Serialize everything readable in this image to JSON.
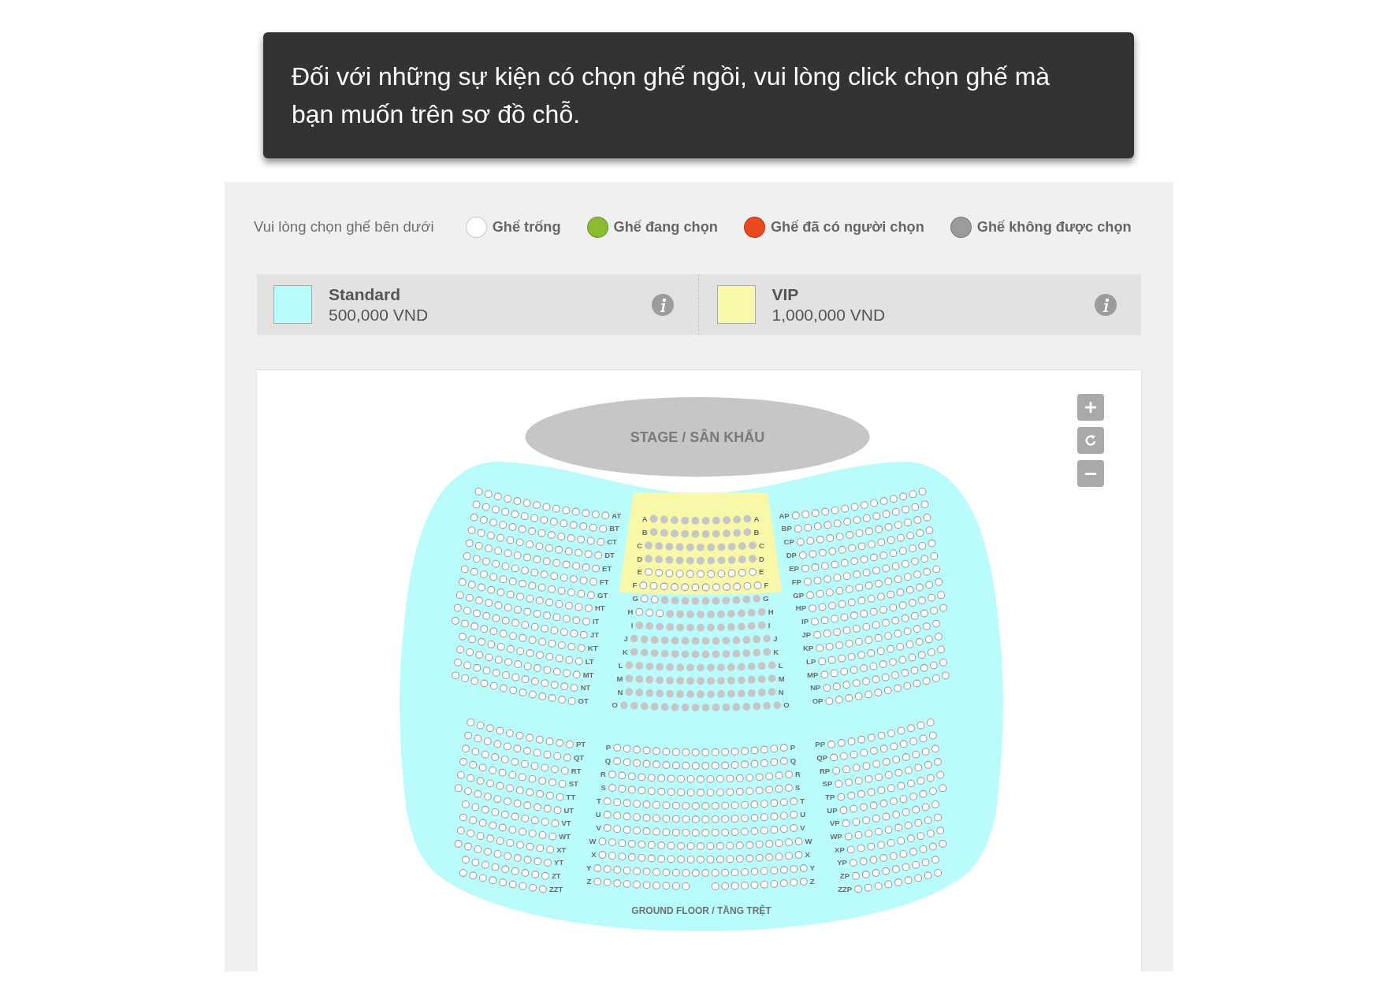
{
  "notice": {
    "text": "Đối với những sự kiện có chọn ghế ngồi, vui lòng click chọn ghế mà bạn muốn trên sơ đồ chỗ."
  },
  "legend": {
    "prompt": "Vui lòng chọn ghế bên dưới",
    "items": [
      {
        "label": "Ghế trống",
        "color": "#ffffff"
      },
      {
        "label": "Ghế đang chọn",
        "color": "#8bbb30"
      },
      {
        "label": "Ghế đã có người chọn",
        "color": "#e9491c"
      },
      {
        "label": "Ghế không được chọn",
        "color": "#9b9b9b"
      }
    ]
  },
  "price_categories": [
    {
      "kind": "standard",
      "name": "Standard",
      "price": "500,000 VND",
      "color": "#bafcfc"
    },
    {
      "kind": "vip",
      "name": "VIP",
      "price": "1,000,000 VND",
      "color": "#f9f7a8"
    }
  ],
  "seat_map": {
    "stage": "STAGE / SÂN KHẤU",
    "zoom_controls": [
      {
        "kind": "zoom_in"
      },
      {
        "kind": "reset"
      },
      {
        "kind": "zoom_out"
      }
    ],
    "sections": [
      {
        "kind": "left",
        "rows": [
          {
            "labels": [
              "AT"
            ],
            "blocked": [
              false,
              false,
              false,
              false,
              false,
              false,
              false,
              false,
              false,
              false,
              false,
              false,
              false,
              false
            ]
          },
          {
            "labels": [
              "BT"
            ],
            "blocked": [
              false,
              false,
              false,
              false,
              false,
              false,
              false,
              false,
              false,
              false,
              false,
              false,
              false,
              false
            ]
          },
          {
            "labels": [
              "CT"
            ],
            "blocked": [
              false,
              false,
              false,
              false,
              false,
              false,
              false,
              false,
              false,
              false,
              false,
              false,
              false,
              false
            ]
          },
          {
            "labels": [
              "DT"
            ],
            "blocked": [
              false,
              false,
              false,
              false,
              false,
              false,
              false,
              false,
              false,
              false,
              false,
              false,
              false,
              false
            ]
          },
          {
            "labels": [
              "ET"
            ],
            "blocked": [
              false,
              false,
              false,
              false,
              false,
              false,
              false,
              false,
              false,
              false,
              false,
              false,
              false,
              false
            ]
          },
          {
            "labels": [
              "FT"
            ],
            "blocked": [
              false,
              false,
              false,
              false,
              false,
              false,
              false,
              false,
              false,
              false,
              false,
              false,
              false,
              false
            ]
          },
          {
            "labels": [
              "GT"
            ],
            "blocked": [
              false,
              false,
              false,
              false,
              false,
              false,
              false,
              false,
              false,
              false,
              false,
              false,
              false,
              false
            ]
          },
          {
            "labels": [
              "HT"
            ],
            "blocked": [
              false,
              false,
              false,
              false,
              false,
              false,
              false,
              false,
              false,
              false,
              false,
              false,
              false,
              false
            ]
          },
          {
            "labels": [
              "IT"
            ],
            "blocked": [
              false,
              false,
              false,
              false,
              false,
              false,
              false,
              false,
              false,
              false,
              false,
              false,
              false,
              false
            ]
          },
          {
            "labels": [
              "JT"
            ],
            "blocked": [
              false,
              false,
              false,
              false,
              false,
              false,
              false,
              false,
              false,
              false,
              false,
              false,
              false,
              false
            ]
          },
          {
            "labels": [
              "KT"
            ],
            "blocked": [
              false,
              false,
              false,
              false,
              false,
              false,
              false,
              false,
              false,
              false,
              false,
              false,
              false,
              false
            ]
          },
          {
            "labels": [
              "LT"
            ],
            "blocked": [
              false,
              false,
              false,
              false,
              false,
              false,
              false,
              false,
              false,
              false,
              false,
              false,
              false
            ]
          },
          {
            "labels": [
              "MT"
            ],
            "blocked": [
              false,
              false,
              false,
              false,
              false,
              false,
              false,
              false,
              false,
              false,
              false,
              false,
              false
            ]
          },
          {
            "labels": [
              "NT"
            ],
            "blocked": [
              false,
              false,
              false,
              false,
              false,
              false,
              false,
              false,
              false,
              false,
              false,
              false,
              false
            ]
          },
          {
            "labels": [
              "OT"
            ],
            "blocked": [
              false,
              false,
              false,
              false,
              false,
              false,
              false,
              false,
              false,
              false,
              false,
              false,
              false
            ]
          }
        ]
      },
      {
        "kind": "center",
        "vip": true,
        "rows": [
          {
            "labels": [
              "A",
              "A"
            ],
            "blocked": [
              true,
              true,
              true,
              true,
              true,
              true,
              true,
              true,
              true,
              true
            ]
          },
          {
            "labels": [
              "B",
              "B"
            ],
            "blocked": [
              true,
              true,
              true,
              true,
              true,
              true,
              true,
              true,
              true,
              true
            ]
          },
          {
            "labels": [
              "C",
              "C"
            ],
            "blocked": [
              true,
              true,
              true,
              true,
              true,
              true,
              true,
              true,
              true,
              true,
              true
            ]
          },
          {
            "labels": [
              "D",
              "D"
            ],
            "blocked": [
              true,
              true,
              true,
              true,
              true,
              true,
              true,
              true,
              true,
              true,
              true
            ]
          },
          {
            "labels": [
              "E",
              "E"
            ],
            "blocked": [
              false,
              false,
              false,
              false,
              false,
              false,
              false,
              false,
              false,
              false,
              false
            ]
          },
          {
            "labels": [
              "F",
              "F"
            ],
            "blocked": [
              false,
              false,
              false,
              false,
              false,
              false,
              false,
              false,
              false,
              false,
              false,
              false
            ]
          }
        ]
      },
      {
        "kind": "center",
        "rows": [
          {
            "labels": [
              "G",
              "G"
            ],
            "blocked": [
              false,
              false,
              true,
              true,
              true,
              true,
              true,
              true,
              true,
              true,
              true,
              true
            ]
          },
          {
            "labels": [
              "H",
              "H"
            ],
            "blocked": [
              false,
              false,
              false,
              true,
              true,
              true,
              true,
              true,
              true,
              true,
              true,
              true,
              true
            ]
          },
          {
            "labels": [
              "I",
              "I"
            ],
            "blocked": [
              true,
              true,
              true,
              true,
              true,
              true,
              true,
              true,
              true,
              true,
              true,
              true,
              true
            ]
          },
          {
            "labels": [
              "J",
              "J"
            ],
            "blocked": [
              true,
              true,
              true,
              true,
              true,
              true,
              true,
              true,
              true,
              true,
              true,
              true,
              true,
              true
            ]
          },
          {
            "labels": [
              "K",
              "K"
            ],
            "blocked": [
              true,
              true,
              true,
              true,
              true,
              true,
              true,
              true,
              true,
              true,
              true,
              true,
              true,
              true
            ]
          },
          {
            "labels": [
              "L",
              "L"
            ],
            "blocked": [
              true,
              true,
              true,
              true,
              true,
              true,
              true,
              true,
              true,
              true,
              true,
              true,
              true,
              true,
              true
            ]
          },
          {
            "labels": [
              "M",
              "M"
            ],
            "blocked": [
              true,
              true,
              true,
              true,
              true,
              true,
              true,
              true,
              true,
              true,
              true,
              true,
              true,
              true,
              true
            ]
          },
          {
            "labels": [
              "N",
              "N"
            ],
            "blocked": [
              true,
              true,
              true,
              true,
              true,
              true,
              true,
              true,
              true,
              true,
              true,
              true,
              true,
              true,
              true
            ]
          },
          {
            "labels": [
              "O",
              "O"
            ],
            "blocked": [
              true,
              true,
              true,
              true,
              true,
              true,
              true,
              true,
              true,
              true,
              true,
              true,
              true,
              true,
              true,
              true
            ]
          }
        ]
      },
      {
        "kind": "right",
        "rows": [
          {
            "labels": [
              "AP"
            ],
            "blocked": [
              false,
              false,
              false,
              false,
              false,
              false,
              false,
              false,
              false,
              false,
              false,
              false,
              false,
              false
            ]
          },
          {
            "labels": [
              "BP"
            ],
            "blocked": [
              false,
              false,
              false,
              false,
              false,
              false,
              false,
              false,
              false,
              false,
              false,
              false,
              false,
              false
            ]
          },
          {
            "labels": [
              "CP"
            ],
            "blocked": [
              false,
              false,
              false,
              false,
              false,
              false,
              false,
              false,
              false,
              false,
              false,
              false,
              false,
              false
            ]
          },
          {
            "labels": [
              "DP"
            ],
            "blocked": [
              false,
              false,
              false,
              false,
              false,
              false,
              false,
              false,
              false,
              false,
              false,
              false,
              false,
              false
            ]
          },
          {
            "labels": [
              "EP"
            ],
            "blocked": [
              false,
              false,
              false,
              false,
              false,
              false,
              false,
              false,
              false,
              false,
              false,
              false,
              false,
              false
            ]
          },
          {
            "labels": [
              "FP"
            ],
            "blocked": [
              false,
              false,
              false,
              false,
              false,
              false,
              false,
              false,
              false,
              false,
              false,
              false,
              false,
              false
            ]
          },
          {
            "labels": [
              "GP"
            ],
            "blocked": [
              false,
              false,
              false,
              false,
              false,
              false,
              false,
              false,
              false,
              false,
              false,
              false,
              false,
              false
            ]
          },
          {
            "labels": [
              "HP"
            ],
            "blocked": [
              false,
              false,
              false,
              false,
              false,
              false,
              false,
              false,
              false,
              false,
              false,
              false,
              false,
              false
            ]
          },
          {
            "labels": [
              "IP"
            ],
            "blocked": [
              false,
              false,
              false,
              false,
              false,
              false,
              false,
              false,
              false,
              false,
              false,
              false,
              false,
              false
            ]
          },
          {
            "labels": [
              "JP"
            ],
            "blocked": [
              false,
              false,
              false,
              false,
              false,
              false,
              false,
              false,
              false,
              false,
              false,
              false,
              false,
              false
            ]
          },
          {
            "labels": [
              "KP"
            ],
            "blocked": [
              false,
              false,
              false,
              false,
              false,
              false,
              false,
              false,
              false,
              false,
              false,
              false,
              false
            ]
          },
          {
            "labels": [
              "LP"
            ],
            "blocked": [
              false,
              false,
              false,
              false,
              false,
              false,
              false,
              false,
              false,
              false,
              false,
              false,
              false
            ]
          },
          {
            "labels": [
              "MP"
            ],
            "blocked": [
              false,
              false,
              false,
              false,
              false,
              false,
              false,
              false,
              false,
              false,
              false,
              false,
              false
            ]
          },
          {
            "labels": [
              "NP"
            ],
            "blocked": [
              false,
              false,
              false,
              false,
              false,
              false,
              false,
              false,
              false,
              false,
              false,
              false,
              false
            ]
          },
          {
            "labels": [
              "OP"
            ],
            "blocked": [
              false,
              false,
              false,
              false,
              false,
              false,
              false,
              false,
              false,
              false,
              false,
              false,
              false
            ]
          }
        ]
      },
      {
        "kind": "left",
        "rows": [
          {
            "labels": [
              "PT"
            ],
            "blocked": [
              false,
              false,
              false,
              false,
              false,
              false,
              false,
              false,
              false,
              false,
              false
            ]
          },
          {
            "labels": [
              "QT"
            ],
            "blocked": [
              false,
              false,
              false,
              false,
              false,
              false,
              false,
              false,
              false,
              false,
              false
            ]
          },
          {
            "labels": [
              "RT"
            ],
            "blocked": [
              false,
              false,
              false,
              false,
              false,
              false,
              false,
              false,
              false,
              false,
              false
            ]
          },
          {
            "labels": [
              "ST"
            ],
            "blocked": [
              false,
              false,
              false,
              false,
              false,
              false,
              false,
              false,
              false,
              false,
              false
            ]
          },
          {
            "labels": [
              "TT"
            ],
            "blocked": [
              false,
              false,
              false,
              false,
              false,
              false,
              false,
              false,
              false,
              false,
              false
            ]
          },
          {
            "labels": [
              "UT"
            ],
            "blocked": [
              false,
              false,
              false,
              false,
              false,
              false,
              false,
              false,
              false,
              false,
              false
            ]
          },
          {
            "labels": [
              "VT"
            ],
            "blocked": [
              false,
              false,
              false,
              false,
              false,
              false,
              false,
              false,
              false,
              false
            ]
          },
          {
            "labels": [
              "WT"
            ],
            "blocked": [
              false,
              false,
              false,
              false,
              false,
              false,
              false,
              false,
              false,
              false
            ]
          },
          {
            "labels": [
              "XT"
            ],
            "blocked": [
              false,
              false,
              false,
              false,
              false,
              false,
              false,
              false,
              false,
              false
            ]
          },
          {
            "labels": [
              "YT"
            ],
            "blocked": [
              false,
              false,
              false,
              false,
              false,
              false,
              false,
              false,
              false,
              false
            ]
          },
          {
            "labels": [
              "ZT"
            ],
            "blocked": [
              false,
              false,
              false,
              false,
              false,
              false,
              false,
              false,
              false
            ]
          },
          {
            "labels": [
              "ZZT"
            ],
            "blocked": [
              false,
              false,
              false,
              false,
              false,
              false,
              false,
              false,
              false
            ]
          }
        ]
      },
      {
        "kind": "center",
        "rows": [
          {
            "labels": [
              "P",
              "P"
            ],
            "blocked": [
              false,
              false,
              false,
              false,
              false,
              false,
              false,
              false,
              false,
              false,
              false,
              false,
              false,
              false,
              false,
              false,
              false,
              false
            ]
          },
          {
            "labels": [
              "Q",
              "Q"
            ],
            "blocked": [
              false,
              false,
              false,
              false,
              false,
              false,
              false,
              false,
              false,
              false,
              false,
              false,
              false,
              false,
              false,
              false,
              false,
              false
            ]
          },
          {
            "labels": [
              "R",
              "R"
            ],
            "blocked": [
              false,
              false,
              false,
              false,
              false,
              false,
              false,
              false,
              false,
              false,
              false,
              false,
              false,
              false,
              false,
              false,
              false,
              false,
              false
            ]
          },
          {
            "labels": [
              "S",
              "S"
            ],
            "blocked": [
              false,
              false,
              false,
              false,
              false,
              false,
              false,
              false,
              false,
              false,
              false,
              false,
              false,
              false,
              false,
              false,
              false,
              false,
              false
            ]
          },
          {
            "labels": [
              "T",
              "T"
            ],
            "blocked": [
              false,
              false,
              false,
              false,
              false,
              false,
              false,
              false,
              false,
              false,
              false,
              false,
              false,
              false,
              false,
              false,
              false,
              false,
              false,
              false
            ]
          },
          {
            "labels": [
              "U",
              "U"
            ],
            "blocked": [
              false,
              false,
              false,
              false,
              false,
              false,
              false,
              false,
              false,
              false,
              false,
              false,
              false,
              false,
              false,
              false,
              false,
              false,
              false,
              false
            ]
          },
          {
            "labels": [
              "V",
              "V"
            ],
            "blocked": [
              false,
              false,
              false,
              false,
              false,
              false,
              false,
              false,
              false,
              false,
              false,
              false,
              false,
              false,
              false,
              false,
              false,
              false,
              false,
              false
            ]
          },
          {
            "labels": [
              "W",
              "W"
            ],
            "blocked": [
              false,
              false,
              false,
              false,
              false,
              false,
              false,
              false,
              false,
              false,
              false,
              false,
              false,
              false,
              false,
              false,
              false,
              false,
              false,
              false,
              false
            ]
          },
          {
            "labels": [
              "X",
              "X"
            ],
            "blocked": [
              false,
              false,
              false,
              false,
              false,
              false,
              false,
              false,
              false,
              false,
              false,
              false,
              false,
              false,
              false,
              false,
              false,
              false,
              false,
              false,
              false
            ]
          },
          {
            "labels": [
              "Y",
              "Y"
            ],
            "blocked": [
              false,
              false,
              false,
              false,
              false,
              false,
              false,
              false,
              false,
              false,
              false,
              false,
              false,
              false,
              false,
              false,
              false,
              false,
              false,
              false,
              false,
              false
            ]
          },
          {
            "labels": [
              "Z",
              "Z"
            ],
            "aisle": true,
            "blocked": [
              false,
              false,
              false,
              false,
              false,
              false,
              false,
              false,
              false,
              false,
              false,
              false,
              false,
              false,
              false,
              false,
              false,
              false,
              false,
              false
            ]
          }
        ]
      },
      {
        "kind": "right",
        "rows": [
          {
            "labels": [
              "PP"
            ],
            "blocked": [
              false,
              false,
              false,
              false,
              false,
              false,
              false,
              false,
              false,
              false,
              false
            ]
          },
          {
            "labels": [
              "QP"
            ],
            "blocked": [
              false,
              false,
              false,
              false,
              false,
              false,
              false,
              false,
              false,
              false,
              false
            ]
          },
          {
            "labels": [
              "RP"
            ],
            "blocked": [
              false,
              false,
              false,
              false,
              false,
              false,
              false,
              false,
              false,
              false,
              false
            ]
          },
          {
            "labels": [
              "SP"
            ],
            "blocked": [
              false,
              false,
              false,
              false,
              false,
              false,
              false,
              false,
              false,
              false,
              false
            ]
          },
          {
            "labels": [
              "TP"
            ],
            "blocked": [
              false,
              false,
              false,
              false,
              false,
              false,
              false,
              false,
              false,
              false,
              false
            ]
          },
          {
            "labels": [
              "UP"
            ],
            "blocked": [
              false,
              false,
              false,
              false,
              false,
              false,
              false,
              false,
              false,
              false,
              false
            ]
          },
          {
            "labels": [
              "VP"
            ],
            "blocked": [
              false,
              false,
              false,
              false,
              false,
              false,
              false,
              false,
              false,
              false
            ]
          },
          {
            "labels": [
              "WP"
            ],
            "blocked": [
              false,
              false,
              false,
              false,
              false,
              false,
              false,
              false,
              false,
              false
            ]
          },
          {
            "labels": [
              "XP"
            ],
            "blocked": [
              false,
              false,
              false,
              false,
              false,
              false,
              false,
              false,
              false,
              false
            ]
          },
          {
            "labels": [
              "YP"
            ],
            "blocked": [
              false,
              false,
              false,
              false,
              false,
              false,
              false,
              false,
              false,
              false
            ]
          },
          {
            "labels": [
              "ZP"
            ],
            "blocked": [
              false,
              false,
              false,
              false,
              false,
              false,
              false,
              false,
              false
            ]
          },
          {
            "labels": [
              "ZZP"
            ],
            "blocked": [
              false,
              false,
              false,
              false,
              false,
              false,
              false,
              false,
              false
            ]
          }
        ]
      }
    ],
    "floor_label": "GROUND FLOOR / TẦNG TRỆT"
  }
}
